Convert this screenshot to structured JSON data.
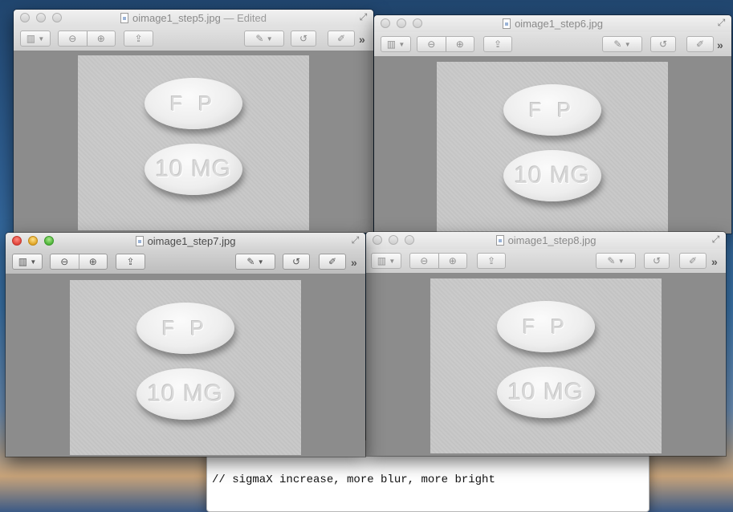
{
  "editor": {
    "code_line": "// sigmaX increase, more blur, more bright"
  },
  "windows": [
    {
      "title": "oimage1_step5.jpg",
      "edited": " — Edited",
      "pill_top": "F P",
      "pill_bottom": "10 MG"
    },
    {
      "title": "oimage1_step6.jpg",
      "edited": "",
      "pill_top": "F P",
      "pill_bottom": "10 MG"
    },
    {
      "title": "oimage1_step7.jpg",
      "edited": "",
      "pill_top": "F P",
      "pill_bottom": "10 MG"
    },
    {
      "title": "oimage1_step8.jpg",
      "edited": "",
      "pill_top": "F P",
      "pill_bottom": "10 MG"
    }
  ],
  "toolbar": {
    "icons": [
      "sidebar-icon",
      "chevron-down-icon",
      "zoom-out-icon",
      "zoom-in-icon",
      "share-icon",
      "markup-pen-icon",
      "rotate-icon",
      "edit-toolbar-icon"
    ],
    "more_label": "»"
  },
  "colors": {
    "close": "#e0443a",
    "minimize": "#e0a526",
    "zoom": "#4fb43a",
    "window_bg": "#8c8c8c"
  }
}
